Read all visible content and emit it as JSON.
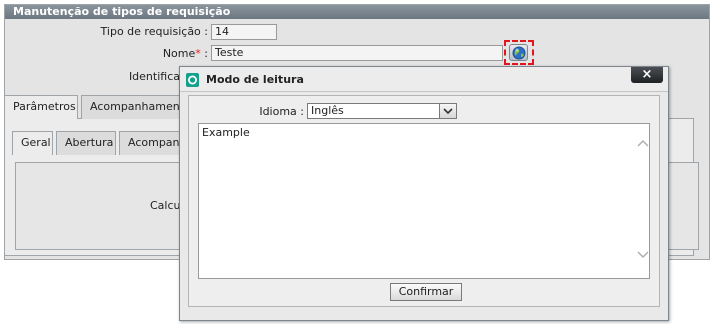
{
  "panel": {
    "title": "Manutenção de tipos de requisição",
    "fields": {
      "tipo_label": "Tipo de requisição :",
      "tipo_value": "14",
      "nome_label": "Nome",
      "nome_required": "*",
      "nome_sep": ":",
      "nome_value": "Teste",
      "ident_label": "Identifica"
    },
    "tabs": [
      "Parâmetros",
      "Acompanhamento"
    ],
    "subtabs": [
      "Geral",
      "Abertura",
      "Acompanh"
    ],
    "body_text": "Calcu"
  },
  "modal": {
    "title": "Modo de leitura",
    "close_label": "×",
    "idioma_label": "Idioma :",
    "idioma_value": "Inglês",
    "text_content": "Example",
    "confirm_label": "Confirmar"
  },
  "colors": {
    "header": "#7b858e",
    "required": "#e8212b",
    "highlight_dash": "#e2141c",
    "close_button": "#2a2d30"
  },
  "icons": [
    "globe-icon",
    "app-icon",
    "close-icon",
    "chevron-down-icon",
    "scroll-up-icon",
    "scroll-down-icon"
  ]
}
